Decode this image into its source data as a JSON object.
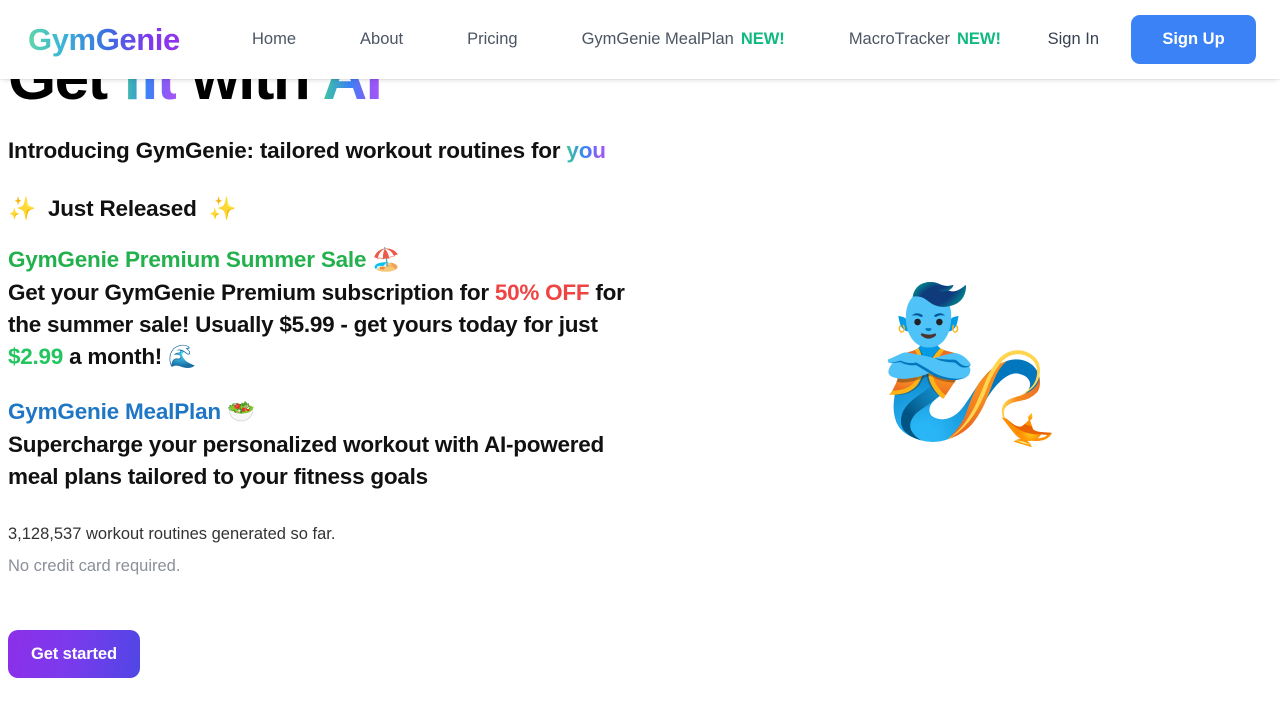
{
  "header": {
    "brand": "GymGenie",
    "nav_items": [
      {
        "label": "Home",
        "badge": ""
      },
      {
        "label": "About",
        "badge": ""
      },
      {
        "label": "Pricing",
        "badge": ""
      },
      {
        "label": "GymGenie MealPlan",
        "badge": "NEW!"
      },
      {
        "label": "MacroTracker",
        "badge": "NEW!"
      }
    ],
    "sign_in_label": "Sign In",
    "sign_up_label": "Sign Up",
    "badge_color": "#10b981",
    "sign_up_color": "#3b82f6"
  },
  "hero": {
    "title_part1": "Get ",
    "title_part2": "fit",
    "title_part3": " with ",
    "title_part4": "AI",
    "subtitle_text": "Introducing GymGenie: tailored workout routines for ",
    "subtitle_highlight": "you",
    "just_released": {
      "emoji_left": "✨",
      "label": "Just Released",
      "emoji_right": "✨"
    },
    "promo_summer": {
      "heading_text": "GymGenie Premium Summer Sale ",
      "heading_emoji": "🏖️",
      "heading_color": "#22b14c",
      "body_1": "Get your GymGenie Premium subscription for ",
      "discount": "50% OFF",
      "discount_color": "#ef4444",
      "body_2": " for the summer sale! Usually $5.99 - get yours today for just ",
      "price": "$2.99",
      "price_color": "#22c55e",
      "body_3": " a month! ",
      "body_emoji": "🌊"
    },
    "promo_mealplan": {
      "heading_text": "GymGenie MealPlan ",
      "heading_emoji": "🥗",
      "heading_color": "#1f76c4",
      "body": "Supercharge your personalized workout with AI-powered meal plans tailored to your fitness goals"
    },
    "stat_routines": "3,128,537 workout routines generated so far.",
    "stat_nocard": "No credit card required.",
    "cta_label": "Get started",
    "illustration_emoji": "🧞"
  }
}
